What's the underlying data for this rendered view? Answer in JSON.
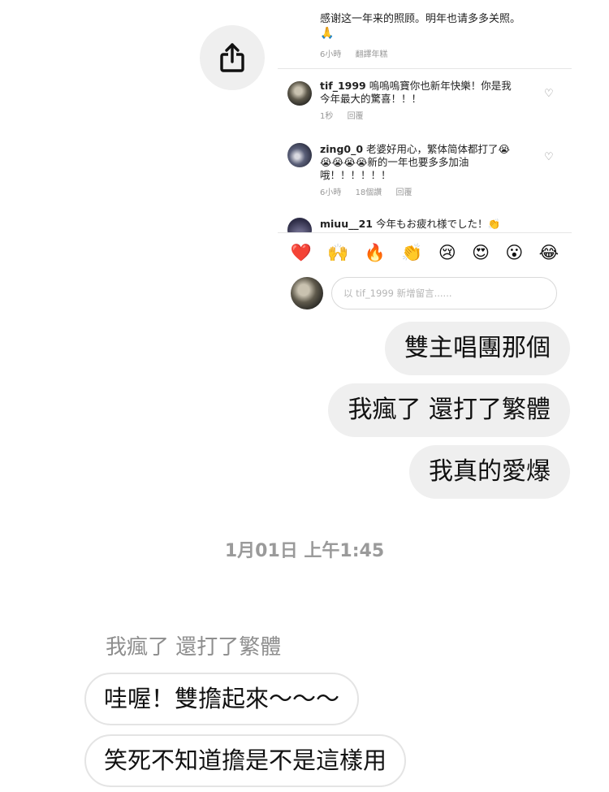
{
  "share": {
    "icon": "share-icon"
  },
  "shared_post": {
    "caption": "感谢这一年来的照顾。明年也请多多关照。",
    "caption_emoji": "🙏",
    "caption_meta": {
      "time": "6小時",
      "translate": "翻譯年糕"
    },
    "comments": [
      {
        "user": "tif_1999",
        "text_line1": "嗚嗚嗚寶你也新年快樂！你是我",
        "text_line2": "今年最大的驚喜！！！",
        "time": "1秒",
        "reply": "回覆"
      },
      {
        "user": "zing0_0",
        "text_line1": "老婆好用心，繁体简体都打了😭",
        "text_line2": "😭😭😭😭新的一年也要多多加油",
        "text_line3": "哦！！！！！！",
        "time": "6小時",
        "likes": "18個讚",
        "reply": "回覆"
      },
      {
        "user": "miuu__21",
        "text_line1": "今年もお疲れ様でした！👏"
      }
    ],
    "emojis": [
      "❤️",
      "🙌",
      "🔥",
      "👏",
      "😢",
      "😍",
      "😮",
      "😂"
    ],
    "comment_placeholder": "以 tif_1999 新增留言......"
  },
  "messages_sent": [
    "雙主唱團那個",
    "我瘋了 還打了繁體",
    "我真的愛爆"
  ],
  "timestamp": "1月01日 上午1:45",
  "reply_quote": "我瘋了 還打了繁體",
  "messages_received": [
    "哇喔！雙擔起來～～～",
    "笑死不知道擔是不是這樣用"
  ]
}
